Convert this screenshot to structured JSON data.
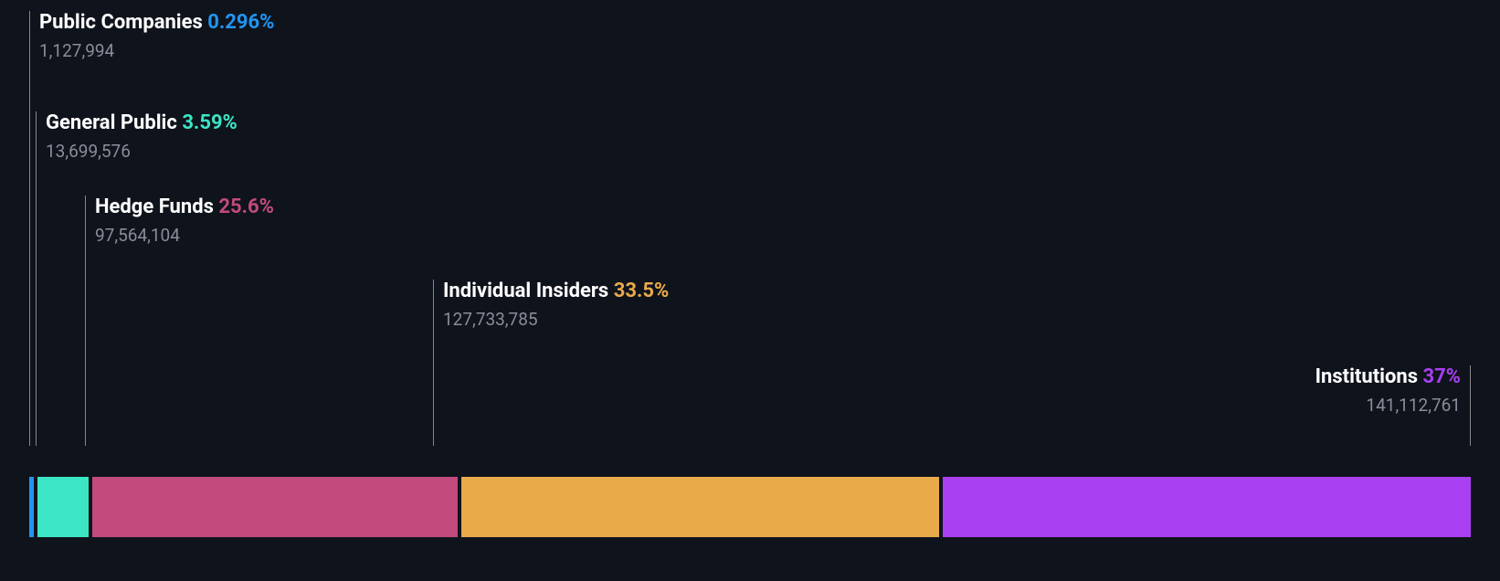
{
  "chart_data": {
    "type": "bar",
    "title": "",
    "series": [
      {
        "name": "Public Companies",
        "percent": 0.296,
        "percent_label": "0.296%",
        "value": 1127994,
        "value_label": "1,127,994",
        "color": "#2196f3"
      },
      {
        "name": "General Public",
        "percent": 3.59,
        "percent_label": "3.59%",
        "value": 13699576,
        "value_label": "13,699,576",
        "color": "#3be6c4"
      },
      {
        "name": "Hedge Funds",
        "percent": 25.6,
        "percent_label": "25.6%",
        "value": 97564104,
        "value_label": "97,564,104",
        "color": "#c24a7d"
      },
      {
        "name": "Individual Insiders",
        "percent": 33.5,
        "percent_label": "33.5%",
        "value": 127733785,
        "value_label": "127,733,785",
        "color": "#e9aa4a"
      },
      {
        "name": "Institutions",
        "percent": 37.0,
        "percent_label": "37%",
        "value": 141112761,
        "value_label": "141,112,761",
        "color": "#a83ff0"
      }
    ]
  }
}
